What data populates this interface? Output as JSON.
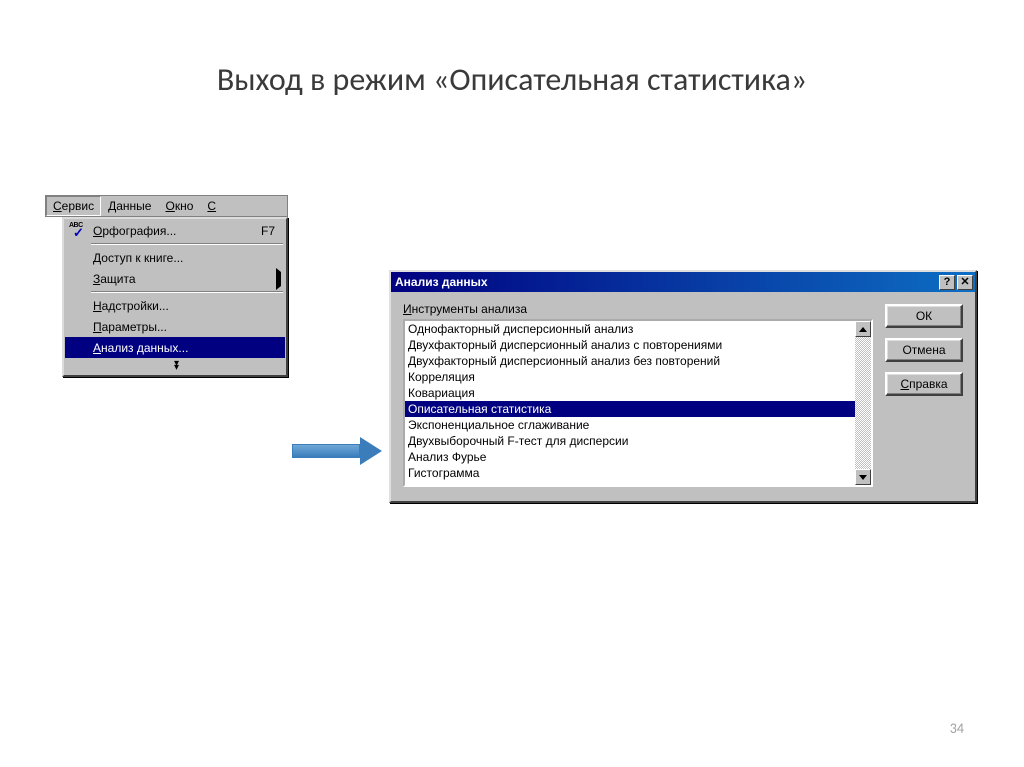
{
  "slide": {
    "title": "Выход в режим «Описательная статистика»",
    "page_number": "34"
  },
  "menubar": {
    "items": [
      "Сервис",
      "Данные",
      "Окно",
      "С"
    ],
    "underlines": [
      "С",
      "Д",
      "О",
      ""
    ],
    "pressed_index": 0
  },
  "dropdown": {
    "items": [
      {
        "label": "Орфография...",
        "underline": "О",
        "shortcut": "F7",
        "has_icon": true
      },
      {
        "sep": true
      },
      {
        "label": "Доступ к книге...",
        "underline": "Д"
      },
      {
        "label": "Защита",
        "underline": "З",
        "submenu": true
      },
      {
        "sep": true
      },
      {
        "label": "Надстройки...",
        "underline": "Н"
      },
      {
        "label": "Параметры...",
        "underline": "П"
      },
      {
        "label": "Анализ данных...",
        "underline": "А",
        "selected": true
      }
    ]
  },
  "dialog": {
    "title": "Анализ данных",
    "group_label": "Инструменты анализа",
    "buttons": {
      "ok": "ОК",
      "cancel": "Отмена",
      "help": "Справка",
      "help_underline": "С"
    },
    "list": [
      "Однофакторный дисперсионный анализ",
      "Двухфакторный дисперсионный анализ с повторениями",
      "Двухфакторный дисперсионный анализ без повторений",
      "Корреляция",
      "Ковариация",
      "Описательная статистика",
      "Экспоненциальное сглаживание",
      "Двухвыборочный F-тест для дисперсии",
      "Анализ Фурье",
      "Гистограмма"
    ],
    "selected_index": 5
  }
}
